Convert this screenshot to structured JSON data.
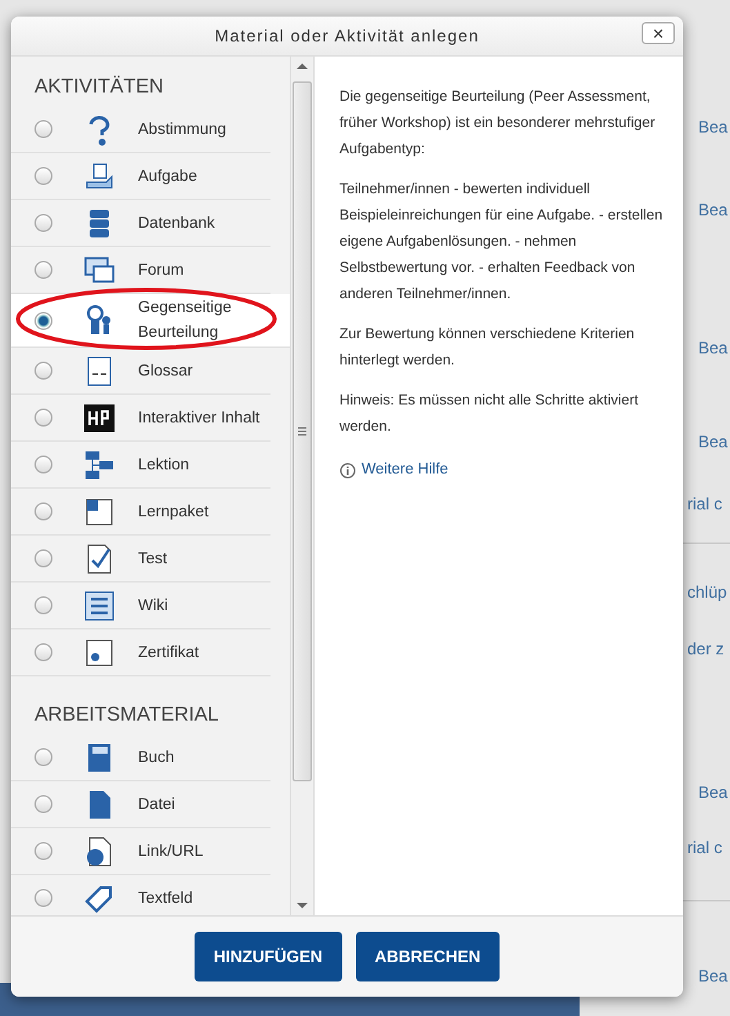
{
  "background": {
    "links": [
      "Bea",
      "Bea",
      "Bea",
      "Bea",
      "rial c",
      "chlüp",
      "der z",
      "Bea",
      "rial c",
      "Bea"
    ]
  },
  "dialog": {
    "title": "Material oder Aktivität anlegen",
    "close": "×",
    "sections": [
      {
        "title": "AKTIVITÄTEN",
        "items": [
          {
            "label": "Abstimmung",
            "selected": false
          },
          {
            "label": "Aufgabe",
            "selected": false
          },
          {
            "label": "Datenbank",
            "selected": false
          },
          {
            "label": "Forum",
            "selected": false
          },
          {
            "label": "Gegenseitige Beurteilung",
            "selected": true
          },
          {
            "label": "Glossar",
            "selected": false
          },
          {
            "label": "Interaktiver Inhalt",
            "selected": false
          },
          {
            "label": "Lektion",
            "selected": false
          },
          {
            "label": "Lernpaket",
            "selected": false
          },
          {
            "label": "Test",
            "selected": false
          },
          {
            "label": "Wiki",
            "selected": false
          },
          {
            "label": "Zertifikat",
            "selected": false
          }
        ]
      },
      {
        "title": "ARBEITSMATERIAL",
        "items": [
          {
            "label": "Buch",
            "selected": false
          },
          {
            "label": "Datei",
            "selected": false
          },
          {
            "label": "Link/URL",
            "selected": false
          },
          {
            "label": "Textfeld",
            "selected": false
          }
        ]
      }
    ],
    "description": [
      "Die gegenseitige Beurteilung (Peer Assessment, früher Workshop) ist ein besonderer mehrstufiger Aufgabentyp:",
      "Teilnehmer/innen - bewerten individuell Beispieleinreichungen für eine Aufgabe. - erstellen eigene Aufgabenlösungen. - nehmen Selbstbewertung vor. - erhalten Feedback von anderen Teilnehmer/innen.",
      "Zur Bewertung können verschiedene Kriterien hinterlegt werden.",
      "Hinweis: Es müssen nicht alle Schritte aktiviert werden."
    ],
    "help_link": "Weitere Hilfe",
    "buttons": [
      "HINZUFÜGEN",
      "ABBRECHEN"
    ]
  }
}
